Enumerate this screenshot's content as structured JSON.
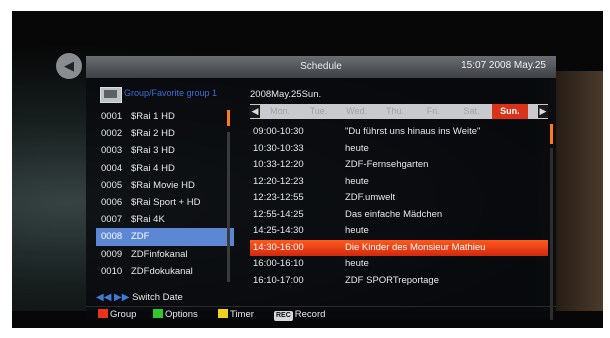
{
  "title": "Schedule",
  "clock": "15:07 2008 May.25",
  "group_label": "Group/Favorite group 1",
  "channels": [
    {
      "num": "0001",
      "name": "$Rai 1 HD"
    },
    {
      "num": "0002",
      "name": "$Rai 2 HD"
    },
    {
      "num": "0003",
      "name": "$Rai 3 HD"
    },
    {
      "num": "0004",
      "name": "$Rai 4 HD"
    },
    {
      "num": "0005",
      "name": "$Rai Movie HD"
    },
    {
      "num": "0006",
      "name": "$Rai Sport + HD"
    },
    {
      "num": "0007",
      "name": "$Rai 4K"
    },
    {
      "num": "0008",
      "name": "ZDF"
    },
    {
      "num": "0009",
      "name": "ZDFinfokanal"
    },
    {
      "num": "0010",
      "name": "ZDFdokukanal"
    }
  ],
  "selected_channel_index": 7,
  "switch_date_label": "Switch Date",
  "date_label": "2008May.25Sun.",
  "days": [
    "Mon.",
    "Tue.",
    "Wed.",
    "Thu.",
    "Fri.",
    "Sat.",
    "Sun."
  ],
  "active_day_index": 6,
  "events": [
    {
      "time": "09:00-10:30",
      "name": "\"Du führst uns hinaus ins Weite\""
    },
    {
      "time": "10:30-10:33",
      "name": "heute"
    },
    {
      "time": "10:33-12:20",
      "name": "ZDF-Fernsehgarten"
    },
    {
      "time": "12:20-12:23",
      "name": "heute"
    },
    {
      "time": "12:23-12:55",
      "name": "ZDF.umwelt"
    },
    {
      "time": "12:55-14:25",
      "name": "Das einfache Mädchen"
    },
    {
      "time": "14:25-14:30",
      "name": "heute"
    },
    {
      "time": "14:30-16:00",
      "name": "Die Kinder des Monsieur Mathieu"
    },
    {
      "time": "16:00-16:10",
      "name": "heute"
    },
    {
      "time": "16:10-17:00",
      "name": "ZDF SPORTreportage"
    }
  ],
  "selected_event_index": 7,
  "legend": [
    {
      "label": "Group",
      "color": "#e8321e"
    },
    {
      "label": "Options",
      "color": "#2ec82a"
    },
    {
      "label": "Timer",
      "color": "#f2d21a"
    },
    {
      "label": "Record",
      "badge": "REC"
    }
  ]
}
